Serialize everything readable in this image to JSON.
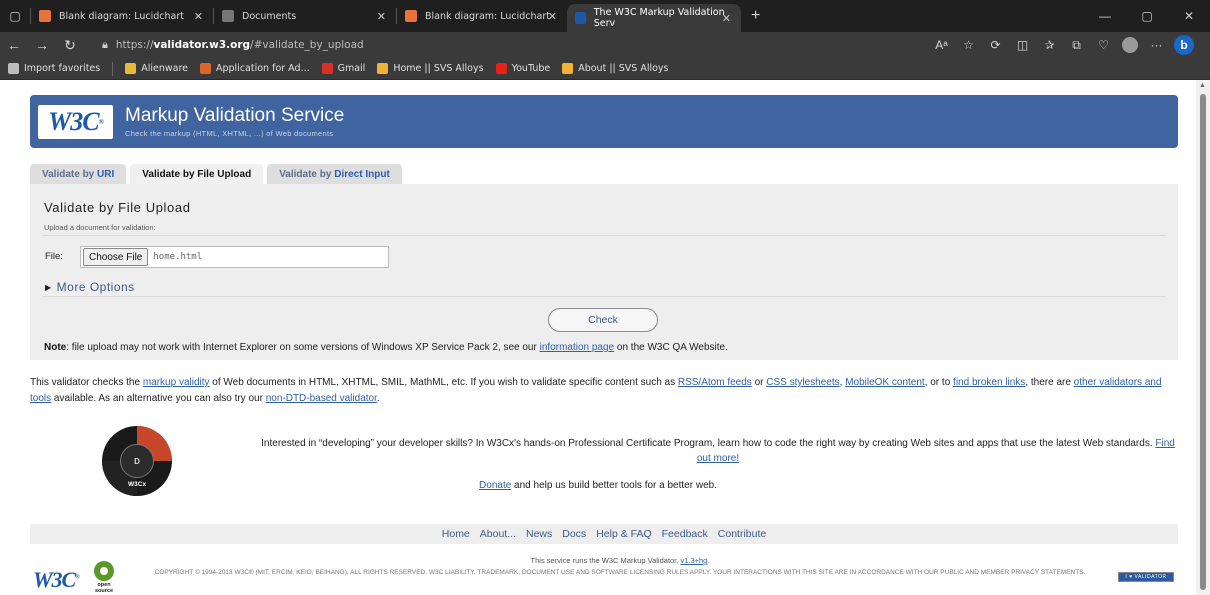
{
  "browser": {
    "tabs": [
      {
        "title": "Blank diagram: Lucidchart",
        "color": "#e8743b"
      },
      {
        "title": "Documents",
        "color": "#888888"
      },
      {
        "title": "Blank diagram: Lucidchart",
        "color": "#e8743b"
      },
      {
        "title": "The W3C Markup Validation Serv",
        "color": "#1c5aa8"
      }
    ],
    "url_scheme": "https://",
    "url_domain": "validator.w3.org",
    "url_path": "/#validate_by_upload",
    "bookmarks": [
      {
        "label": "Import favorites",
        "color": "#bdbdbd"
      },
      {
        "label": "Alienware",
        "color": "#e8b93b"
      },
      {
        "label": "Application for Ad...",
        "color": "#d9662a"
      },
      {
        "label": "Gmail",
        "color": "#d93025"
      },
      {
        "label": "Home || SVS Alloys",
        "color": "#f2b233"
      },
      {
        "label": "YouTube",
        "color": "#e62117"
      },
      {
        "label": "About || SVS Alloys",
        "color": "#f2b233"
      }
    ],
    "bing_label": "b"
  },
  "header": {
    "logo_text": "W3C",
    "logo_reg": "®",
    "title": "Markup Validation Service",
    "subtitle": "Check the markup (HTML, XHTML, ...) of Web documents"
  },
  "tabs": {
    "uri_prefix": "Validate by ",
    "uri_link": "URI",
    "upload_label": "Validate by File Upload",
    "direct_prefix": "Validate by ",
    "direct_link": "Direct Input"
  },
  "upload": {
    "heading": "Validate by File Upload",
    "subheading": "Upload a document for validation:",
    "file_label": "File:",
    "choose_label": "Choose File",
    "file_name": "home.html",
    "more_options": "More Options",
    "check_label": "Check",
    "note_bold": "Note",
    "note_text": ": file upload may not work with Internet Explorer on some versions of Windows XP Service Pack 2, see our ",
    "note_link": "information page",
    "note_tail": " on the W3C QA Website."
  },
  "intro": {
    "p1": "This validator checks the ",
    "l1": "markup validity",
    "p2": " of Web documents in HTML, XHTML, SMIL, MathML, etc. If you wish to validate specific content such as ",
    "l2": "RSS/Atom feeds",
    "p3": " or ",
    "l3": "CSS stylesheets",
    "p4": ", ",
    "l4": "MobileOK content",
    "p5": ", or to ",
    "l5": "find broken links",
    "p6": ", there are ",
    "l6": "other validators and tools",
    "p7": " available. As an alternative you can also try our ",
    "l7": "non-DTD-based validator",
    "p8": "."
  },
  "promo": {
    "text": "Interested in “developing” your developer skills? In W3Cx's hands-on Professional Certificate Program, learn how to code the right way by creating Web sites and apps that use the latest Web standards. ",
    "link": "Find out more!",
    "badge_core": "D",
    "badge_label": "W3Cx",
    "donate_link": "Donate",
    "donate_text": " and help us build better tools for a better web."
  },
  "footer": {
    "nav": [
      "Home",
      "About...",
      "News",
      "Docs",
      "Help & FAQ",
      "Feedback",
      "Contribute"
    ],
    "runs_text": "This service runs the W3C Markup Validator, ",
    "runs_version": "v1.3+hg",
    "runs_end": ".",
    "copyright": "COPYRIGHT © 1994-2013 W3C® (MIT, ERCIM, KEIO, BEIHANG), ALL RIGHTS RESERVED. W3C LIABILITY, TRADEMARK, DOCUMENT USE AND SOFTWARE LICENSING RULES APPLY. YOUR INTERACTIONS WITH THIS SITE ARE IN ACCORDANCE WITH OUR PUBLIC AND MEMBER PRIVACY STATEMENTS.",
    "logo_text": "W3C",
    "logo_reg": "®",
    "opensource_label": "open source",
    "validator_badge": "I ♥ VALIDATOR"
  }
}
